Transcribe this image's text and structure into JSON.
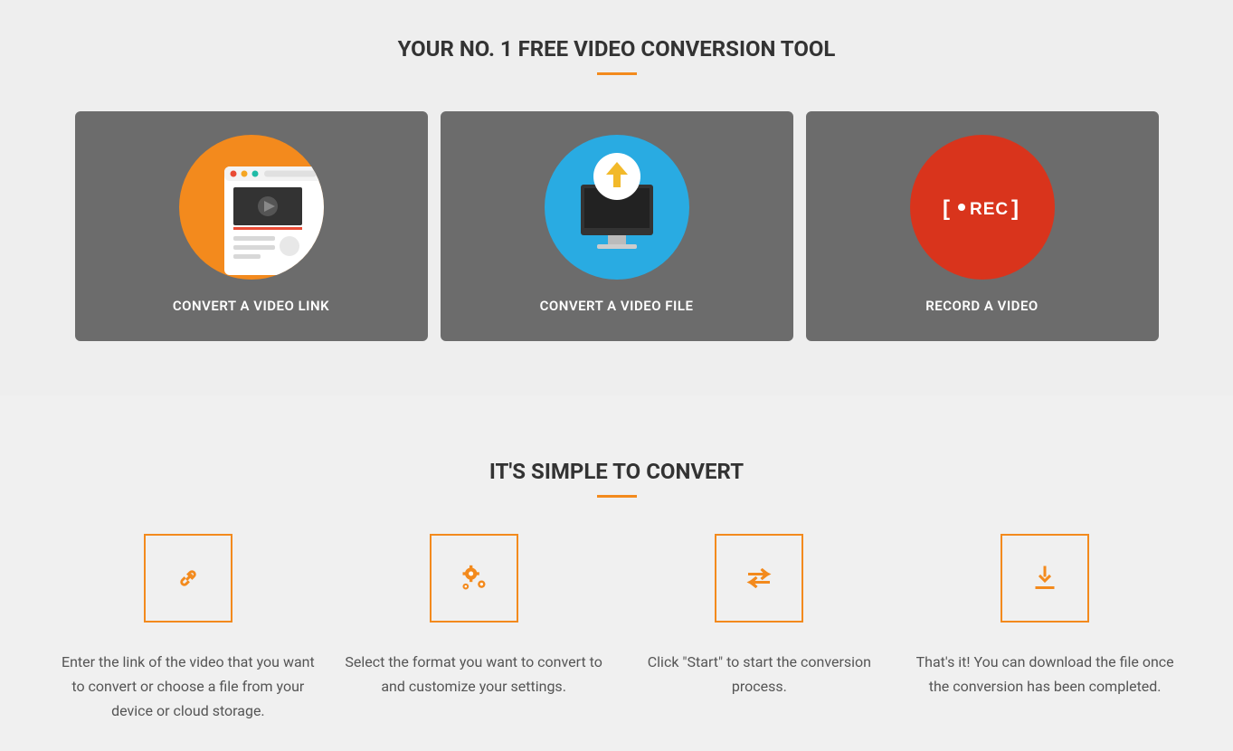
{
  "hero": {
    "title": "YOUR NO. 1 FREE VIDEO CONVERSION TOOL",
    "cards": [
      {
        "label": "CONVERT A VIDEO LINK"
      },
      {
        "label": "CONVERT A VIDEO FILE"
      },
      {
        "label": "RECORD A VIDEO",
        "rec_text": "REC"
      }
    ]
  },
  "simple": {
    "title": "IT'S SIMPLE TO CONVERT",
    "steps": [
      {
        "text": "Enter the link of the video that you want to convert or choose a file from your device or cloud storage."
      },
      {
        "text": "Select the format you want to convert to and customize your settings."
      },
      {
        "text": "Click \"Start\" to start the conversion process."
      },
      {
        "text": "That's it! You can download the file once the conversion has been completed."
      }
    ]
  },
  "colors": {
    "accent": "#f38a1d",
    "card_bg": "#6c6c6c",
    "blue": "#29abe2",
    "red": "#d9341c"
  }
}
